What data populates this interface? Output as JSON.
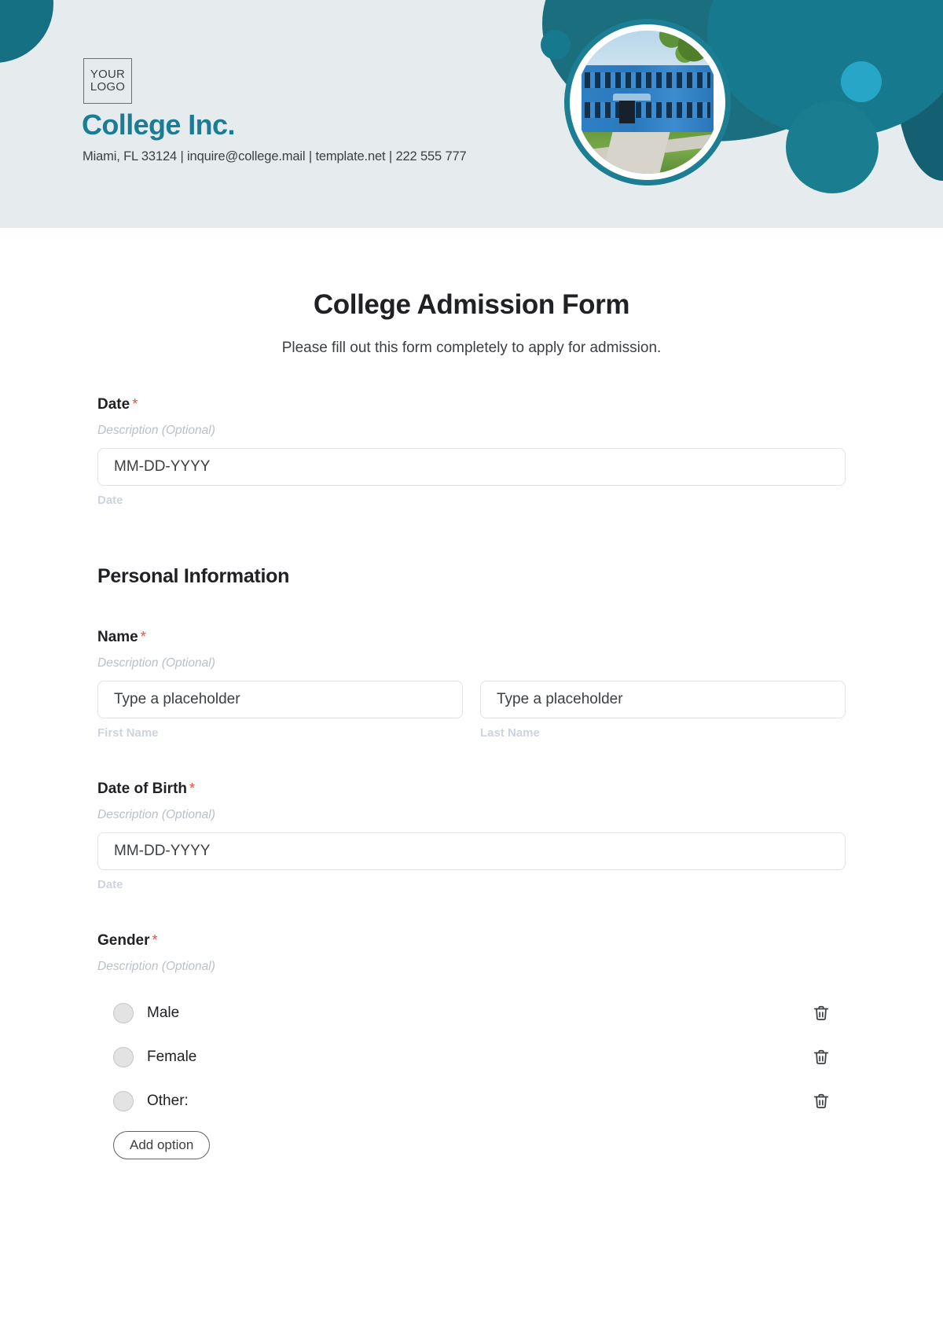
{
  "header": {
    "logo_line1": "YOUR",
    "logo_line2": "LOGO",
    "brand_name": "College Inc.",
    "contact": "Miami, FL 33124 | inquire@college.mail | template.net | 222 555 777",
    "colors": {
      "band_background": "#e6ecee",
      "brand_teal": "#1b7d95",
      "deco_dark_teal": "#157084",
      "deco_cyan": "#27a6c8"
    }
  },
  "form": {
    "title": "College Admission Form",
    "subtitle": "Please fill out this form completely to apply for admission.",
    "required_marker": "*",
    "description_placeholder": "Description (Optional)",
    "fields": {
      "date": {
        "label": "Date",
        "description": "Description (Optional)",
        "value": "MM-DD-YYYY",
        "helper": "Date"
      },
      "name": {
        "label": "Name",
        "description": "Description (Optional)",
        "first": {
          "value": "Type a placeholder",
          "helper": "First Name"
        },
        "last": {
          "value": "Type a placeholder",
          "helper": "Last Name"
        }
      },
      "date_of_birth": {
        "label": "Date of Birth",
        "description": "Description (Optional)",
        "value": "MM-DD-YYYY",
        "helper": "Date"
      },
      "gender": {
        "label": "Gender",
        "description": "Description (Optional)",
        "options": [
          {
            "label": "Male"
          },
          {
            "label": "Female"
          },
          {
            "label": "Other:"
          }
        ],
        "add_option_label": "Add option"
      }
    },
    "sections": {
      "personal_information": "Personal Information"
    },
    "colors": {
      "required_asterisk": "#ef4a3c",
      "helper_text": "#cdd4dd",
      "description_text": "#b9c0c9",
      "input_border": "#dfe3e8"
    }
  }
}
